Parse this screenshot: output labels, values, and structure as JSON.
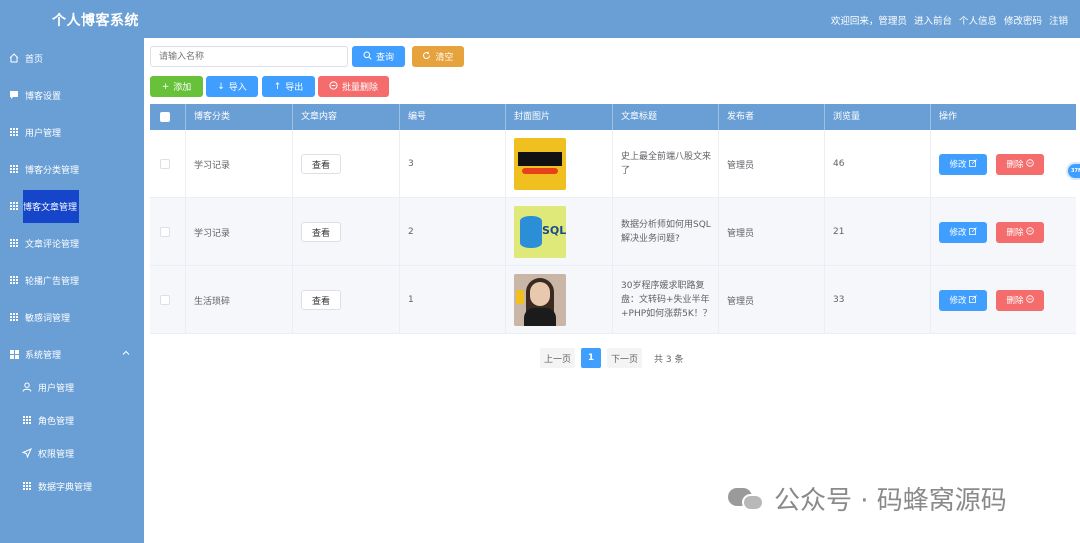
{
  "header": {
    "app_title": "个人博客系统",
    "links": [
      "欢迎回来，管理员",
      "进入前台",
      "个人信息",
      "修改密码",
      "注销"
    ]
  },
  "sidebar": {
    "items": [
      {
        "label": "首页",
        "icon": "home-icon"
      },
      {
        "label": "博客设置",
        "icon": "comment-icon"
      },
      {
        "label": "用户管理",
        "icon": "grid-icon"
      },
      {
        "label": "博客分类管理",
        "icon": "grid-icon"
      },
      {
        "label": "博客文章管理",
        "icon": "grid-icon",
        "active": true
      },
      {
        "label": "文章评论管理",
        "icon": "grid-icon"
      },
      {
        "label": "轮播广告管理",
        "icon": "grid-icon"
      },
      {
        "label": "敏感词管理",
        "icon": "grid-icon"
      },
      {
        "label": "系统管理",
        "icon": "apps-icon",
        "expanded": true
      }
    ],
    "sub_items": [
      {
        "label": "用户管理",
        "icon": "user-icon"
      },
      {
        "label": "角色管理",
        "icon": "grid-icon"
      },
      {
        "label": "权限管理",
        "icon": "send-icon"
      },
      {
        "label": "数据字典管理",
        "icon": "grid-icon"
      }
    ]
  },
  "toolbar": {
    "search_placeholder": "请输入名称",
    "query_label": "查询",
    "clear_label": "清空",
    "add_label": "添加",
    "import_label": "导入",
    "export_label": "导出",
    "batch_delete_label": "批量删除"
  },
  "table": {
    "columns": [
      "博客分类",
      "文章内容",
      "编号",
      "封面图片",
      "文章标题",
      "发布者",
      "浏览量",
      "操作"
    ],
    "rows": [
      {
        "category": "学习记录",
        "content_btn": "查看",
        "id": "3",
        "title": "史上最全前端八股文来了",
        "author": "管理员",
        "views": "46",
        "edit": "修改",
        "delete": "删除"
      },
      {
        "category": "学习记录",
        "content_btn": "查看",
        "id": "2",
        "title": "数据分析师如何用SQL解决业务问题?",
        "author": "管理员",
        "views": "21",
        "edit": "修改",
        "delete": "删除"
      },
      {
        "category": "生活琐碎",
        "content_btn": "查看",
        "id": "1",
        "title": "30岁程序媛求职路复盘：文转码+失业半年+PHP如何涨薪5K！？",
        "author": "管理员",
        "views": "33",
        "edit": "修改",
        "delete": "删除"
      }
    ]
  },
  "pagination": {
    "prev": "上一页",
    "current": "1",
    "next": "下一页",
    "total": "共 3 条"
  },
  "float_badge": "37MB",
  "watermark": "公众号 · 码蜂窝源码",
  "colors": {
    "sidebar_bg": "#6a9fd6",
    "active_bg": "#1546c9",
    "primary": "#409eff",
    "warning": "#e6a23c",
    "success": "#67c23a",
    "danger": "#f56c6c"
  }
}
